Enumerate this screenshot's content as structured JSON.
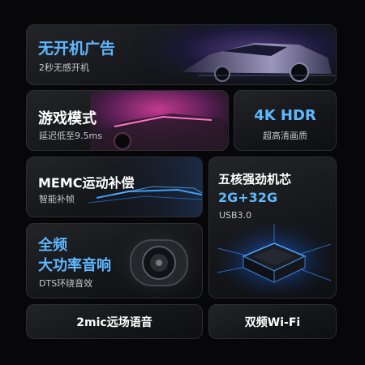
{
  "cards": {
    "no_ads": {
      "title": "无开机广告",
      "sub": "2秒无感开机"
    },
    "game_mode": {
      "title": "游戏模式",
      "sub": "延迟低至9.5ms"
    },
    "hdr": {
      "title": "4K HDR",
      "sub": "超高清画质"
    },
    "memc": {
      "title": "MEMC运动补偿",
      "sub": "智能补帧"
    },
    "cpu": {
      "title": "五核强劲机芯",
      "highlight": "2G+32G",
      "sub": "USB3.0"
    },
    "audio": {
      "title_line1": "全频",
      "title_line2": "大功率音响",
      "sub": "DTS环绕音效"
    },
    "mic": {
      "label": "2mic远场语音"
    },
    "wifi": {
      "label": "双频Wi-Fi"
    }
  },
  "colors": {
    "accent": "#5fb8ff",
    "background": "#070709",
    "card": "#1a1b1e"
  }
}
